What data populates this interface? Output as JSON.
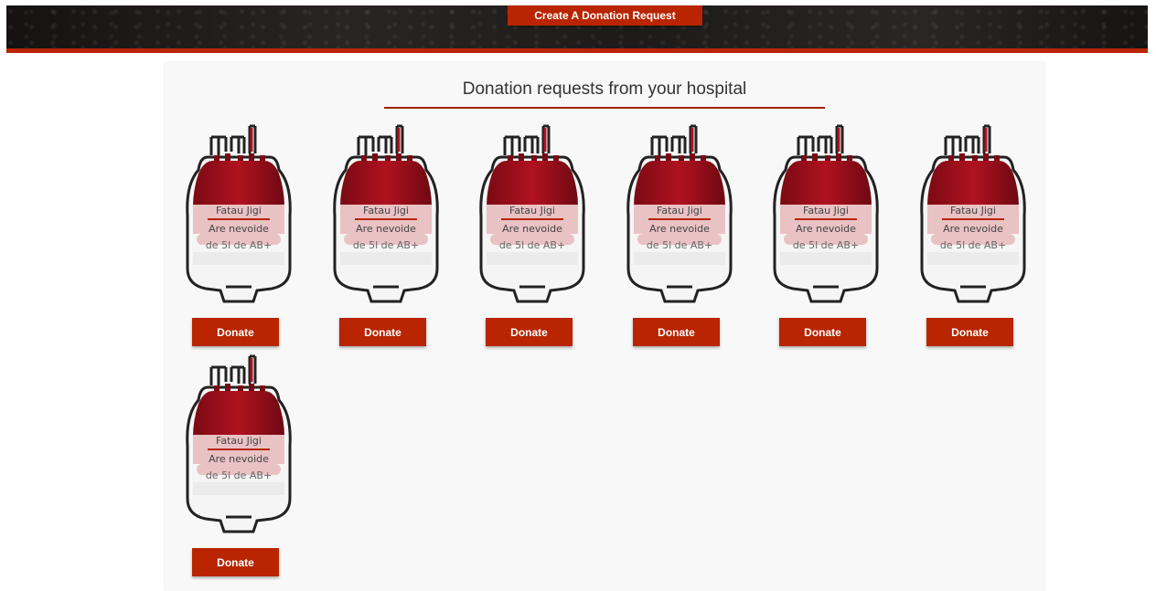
{
  "header": {
    "create_button_label": "Create A Donation Request"
  },
  "panel": {
    "title": "Donation requests from your hospital"
  },
  "requests": [
    {
      "name": "Fatau Jigi",
      "need_text": "Are nevoide",
      "amount_text": "de 5l de AB+",
      "button_label": "Donate"
    },
    {
      "name": "Fatau Jigi",
      "need_text": "Are nevoide",
      "amount_text": "de 5l de AB+",
      "button_label": "Donate"
    },
    {
      "name": "Fatau Jigi",
      "need_text": "Are nevoide",
      "amount_text": "de 5l de AB+",
      "button_label": "Donate"
    },
    {
      "name": "Fatau Jigi",
      "need_text": "Are nevoide",
      "amount_text": "de 5l de AB+",
      "button_label": "Donate"
    },
    {
      "name": "Fatau Jigi",
      "need_text": "Are nevoide",
      "amount_text": "de 5l de AB+",
      "button_label": "Donate"
    },
    {
      "name": "Fatau Jigi",
      "need_text": "Are nevoide",
      "amount_text": "de 5l de AB+",
      "button_label": "Donate"
    },
    {
      "name": "Fatau Jigi",
      "need_text": "Are nevoide",
      "amount_text": "de 5l de AB+",
      "button_label": "Donate"
    }
  ],
  "colors": {
    "accent": "#b82500",
    "blood_dark": "#7a0a14",
    "blood_mid": "#a8121f",
    "panel_bg": "#f8f8f8"
  },
  "icons": {
    "bag": "blood-bag-icon"
  }
}
